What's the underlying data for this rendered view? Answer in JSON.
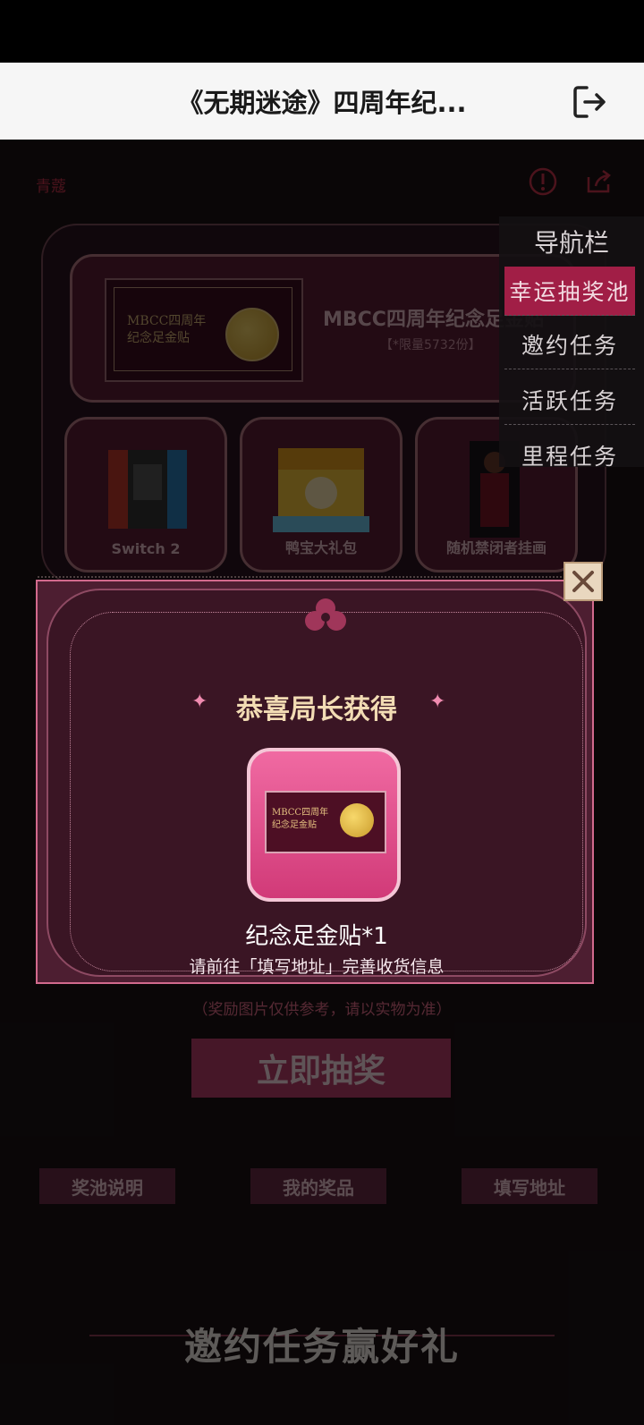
{
  "header": {
    "title": "《无期迷途》四周年纪..."
  },
  "page": {
    "username": "青蔻",
    "big_prize": {
      "name": "MBCC四周年纪念足金贴",
      "limit": "【*限量5732份】",
      "ticket_text": "MBCC四周年 纪念足金贴"
    },
    "small_prizes": [
      {
        "label": "Switch 2"
      },
      {
        "label": "鸭宝大礼包"
      },
      {
        "label": "随机禁闭者挂画"
      }
    ],
    "note": "（奖励图片仅供参考，请以实物为准）",
    "draw_button": "立即抽奖",
    "sub_buttons": [
      "奖池说明",
      "我的奖品",
      "填写地址"
    ],
    "footer_title": "邀约任务赢好礼"
  },
  "nav": {
    "title": "导航栏",
    "items": [
      {
        "label": "幸运抽奖池",
        "active": true
      },
      {
        "label": "邀约任务",
        "active": false
      },
      {
        "label": "活跃任务",
        "active": false
      },
      {
        "label": "里程任务",
        "active": false
      }
    ]
  },
  "modal": {
    "title": "恭喜局长获得",
    "reward_name": "纪念足金贴*1",
    "reward_ticket_text": "MBCC四周年 纪念足金贴",
    "hint": "请前往「填写地址」完善收货信息"
  },
  "colors": {
    "accent": "#a11e46",
    "modal_bg": "#4d1e31",
    "reward_card": "#e8508c",
    "modal_title": "#f2dcb4"
  }
}
